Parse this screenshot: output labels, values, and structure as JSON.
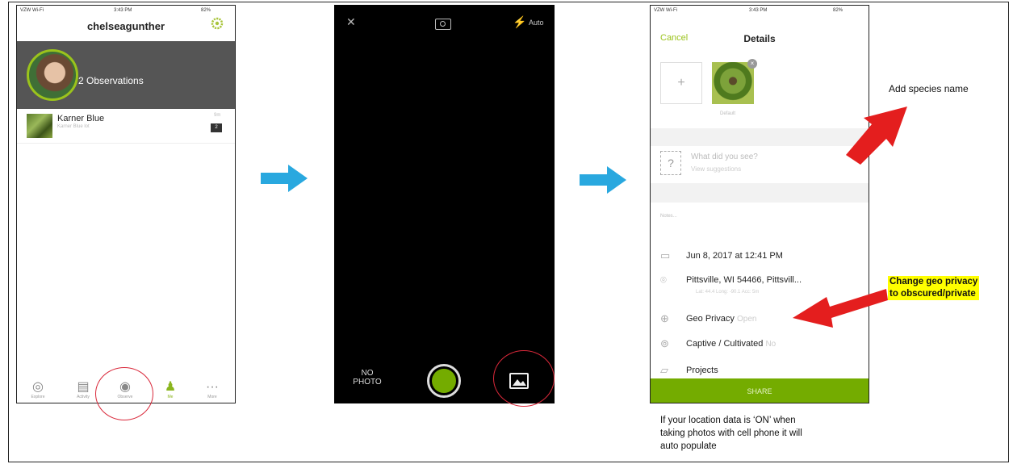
{
  "screen1": {
    "status": {
      "carrier": "VZW Wi-Fi",
      "time": "3:43 PM",
      "battery": "82%"
    },
    "username": "chelseagunther",
    "banner_text": "2 Observations",
    "observation": {
      "title": "Karner Blue",
      "subtitle": "Karner Blue lot",
      "time": "9m",
      "count": "2"
    },
    "tabs": [
      "Explore",
      "Activity",
      "Observe",
      "Me",
      "More"
    ]
  },
  "screen2": {
    "flash_label": "Auto",
    "no_photo_label": "NO\nPHOTO"
  },
  "screen3": {
    "status": {
      "carrier": "VZW Wi-Fi",
      "time": "3:43 PM",
      "battery": "82%"
    },
    "cancel_label": "Cancel",
    "title": "Details",
    "default_label": "Default",
    "species_placeholder": "What did you see?",
    "suggestions_label": "View suggestions",
    "notes_placeholder": "Notes...",
    "date": "Jun 8, 2017 at 12:41 PM",
    "location": "Pittsville, WI 54466, Pittsvill...",
    "location_coords": "Lat: 44.4 Long: -90.1 Acc: 5m",
    "geo_privacy_label": "Geo Privacy",
    "geo_privacy_value": "Open",
    "captive_label": "Captive / Cultivated",
    "captive_value": "No",
    "projects_label": "Projects",
    "share_label": "SHARE"
  },
  "annotations": {
    "species": "Add species name",
    "geo_line1": "Change geo privacy",
    "geo_line2": "to obscured/private",
    "location_note_l1": "If your location data is ‘ON’ when",
    "location_note_l2": "taking photos with cell phone it will",
    "location_note_l3": "auto populate"
  },
  "colors": {
    "green": "#74ac00",
    "arrow_blue": "#29a8df",
    "arrow_red": "#e41e1e",
    "highlight": "#ffff00",
    "banner": "#555555"
  }
}
